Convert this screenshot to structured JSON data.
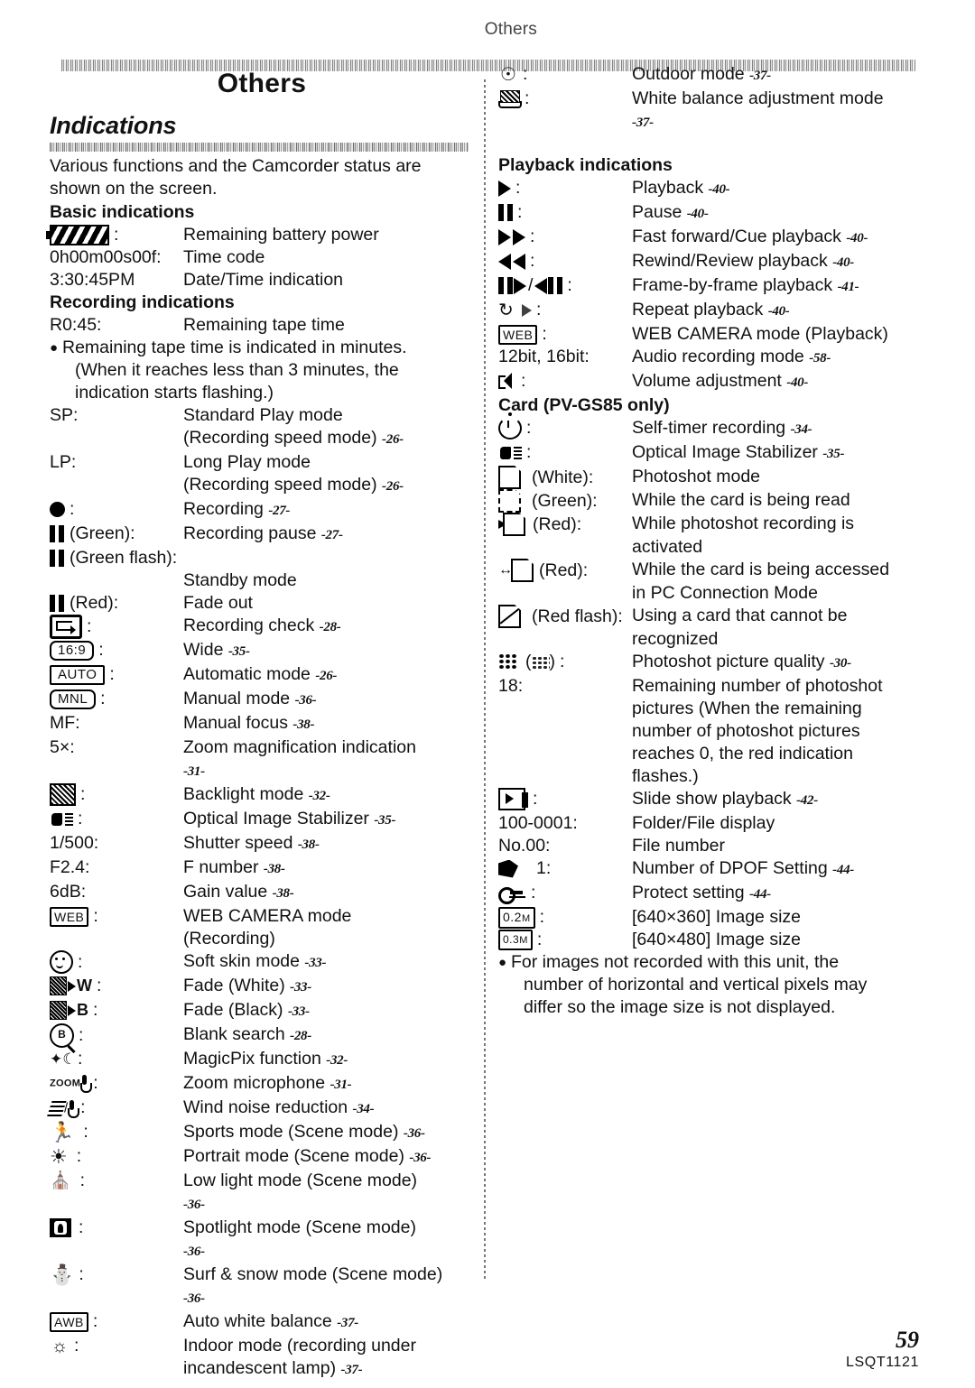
{
  "header": {
    "running_head": "Others"
  },
  "footer": {
    "page_number": "59",
    "doc_code": "LSQT1121"
  },
  "section": {
    "title": "Others",
    "subtitle": "Indications",
    "intro": "Various functions and the Camcorder status are shown on the screen."
  },
  "left_column": {
    "basic_heading": "Basic indications",
    "basic_items": [
      {
        "icon": "battery-icon",
        "term": "",
        "desc": "Remaining battery power",
        "page": ""
      },
      {
        "icon": "",
        "term": "0h00m00s00f:",
        "desc": "Time code",
        "page": ""
      },
      {
        "icon": "",
        "term": "3:30:45PM",
        "desc": "Date/Time indication",
        "page": ""
      }
    ],
    "recording_heading": "Recording indications",
    "recording_items": [
      {
        "icon": "",
        "term": "R0:45:",
        "desc": "Remaining tape time",
        "page": ""
      }
    ],
    "recording_note": "Remaining tape time is indicated in minutes. (When it reaches less than 3 minutes, the indication starts flashing.)",
    "recording_note_lines": [
      "Remaining tape time is indicated in minutes.",
      "(When it reaches less than 3 minutes, the",
      "indication starts flashing.)"
    ],
    "items": [
      {
        "icon": "",
        "term": "SP:",
        "desc": "Standard Play mode",
        "cont": "(Recording speed mode)",
        "page": "-26-"
      },
      {
        "icon": "",
        "term": "LP:",
        "desc": "Long Play mode",
        "cont": "(Recording speed mode)",
        "page": "-26-"
      },
      {
        "icon": "record-dot-icon",
        "term": ":",
        "desc": "Recording",
        "page": "-27-"
      },
      {
        "icon": "pause-bars-icon",
        "term": "(Green):",
        "desc": "Recording pause",
        "page": "-27-"
      },
      {
        "icon": "pause-bars-icon",
        "term": "(Green flash):",
        "desc": "",
        "cont": "Standby mode",
        "page": ""
      },
      {
        "icon": "pause-bars-icon",
        "term": "(Red):",
        "desc": "Fade out",
        "page": ""
      },
      {
        "icon": "recording-check-icon",
        "term": ":",
        "desc": "Recording check",
        "page": "-28-"
      },
      {
        "icon": "wide-16-9-icon",
        "term": ":",
        "desc": "Wide",
        "page": "-35-"
      },
      {
        "icon": "auto-mode-icon",
        "term": ":",
        "desc": "Automatic mode",
        "page": "-26-"
      },
      {
        "icon": "manual-mode-icon",
        "term": ":",
        "desc": "Manual mode",
        "page": "-36-"
      },
      {
        "icon": "",
        "term": "MF:",
        "desc": "Manual focus",
        "page": "-38-"
      },
      {
        "icon": "",
        "term": "5×:",
        "desc": "Zoom magnification indication",
        "cont": "",
        "page": "-31-"
      },
      {
        "icon": "backlight-icon",
        "term": ":",
        "desc": "Backlight mode",
        "page": "-32-"
      },
      {
        "icon": "image-stabilizer-icon",
        "term": ":",
        "desc": "Optical Image Stabilizer",
        "page": "-35-"
      },
      {
        "icon": "",
        "term": "1/500:",
        "desc": "Shutter speed",
        "page": "-38-"
      },
      {
        "icon": "",
        "term": "F2.4:",
        "desc": "F number",
        "page": "-38-"
      },
      {
        "icon": "",
        "term": "6dB:",
        "desc": "Gain value",
        "page": "-38-"
      },
      {
        "icon": "web-camera-icon",
        "term": ":",
        "desc": "WEB CAMERA mode",
        "cont": "(Recording)",
        "page": ""
      },
      {
        "icon": "soft-skin-icon",
        "term": ":",
        "desc": "Soft skin mode",
        "page": "-33-"
      },
      {
        "icon": "fade-white-icon",
        "term": ":",
        "desc": "Fade (White)",
        "page": "-33-"
      },
      {
        "icon": "fade-black-icon",
        "term": ":",
        "desc": "Fade (Black)",
        "page": "-33-"
      },
      {
        "icon": "blank-search-icon",
        "term": ":",
        "desc": "Blank search",
        "page": "-28-"
      },
      {
        "icon": "magicpix-icon",
        "term": ":",
        "desc": "MagicPix function",
        "page": "-32-"
      },
      {
        "icon": "zoom-microphone-icon",
        "term": ":",
        "desc": "Zoom microphone",
        "page": "-31-"
      },
      {
        "icon": "wind-noise-icon",
        "term": ":",
        "desc": "Wind noise reduction",
        "page": "-34-"
      },
      {
        "icon": "sports-mode-icon",
        "term": ":",
        "desc": "Sports mode (Scene mode)",
        "page": "-36-"
      },
      {
        "icon": "portrait-mode-icon",
        "term": ":",
        "desc": "Portrait mode (Scene mode)",
        "page": "-36-"
      },
      {
        "icon": "low-light-mode-icon",
        "term": ":",
        "desc": "Low light mode (Scene mode)",
        "cont": "",
        "page": "-36-"
      },
      {
        "icon": "spotlight-mode-icon",
        "term": ":",
        "desc": "Spotlight mode (Scene mode)",
        "cont": "",
        "page": "-36-"
      },
      {
        "icon": "surf-snow-mode-icon",
        "term": ":",
        "desc": "Surf & snow mode (Scene mode)",
        "cont": "",
        "page": "-36-"
      },
      {
        "icon": "auto-white-balance-icon",
        "term": ":",
        "desc": "Auto white balance",
        "page": "-37-"
      },
      {
        "icon": "indoor-mode-icon",
        "term": ":",
        "desc": "Indoor mode (recording under",
        "cont": "incandescent lamp)",
        "page": "-37-"
      }
    ]
  },
  "right_column": {
    "top_items": [
      {
        "icon": "outdoor-mode-icon",
        "term": ":",
        "desc": "Outdoor mode",
        "page": "-37-"
      },
      {
        "icon": "white-balance-adjust-icon",
        "term": ":",
        "desc": "White balance adjustment mode",
        "cont": "",
        "page": "-37-"
      }
    ],
    "playback_heading": "Playback indications",
    "playback_items": [
      {
        "icon": "play-icon",
        "term": ":",
        "desc": "Playback",
        "page": "-40-"
      },
      {
        "icon": "pause-icon",
        "term": ":",
        "desc": "Pause",
        "page": "-40-"
      },
      {
        "icon": "fast-forward-icon",
        "term": ":",
        "desc": "Fast forward/Cue playback",
        "page": "-40-"
      },
      {
        "icon": "rewind-icon",
        "term": ":",
        "desc": "Rewind/Review playback",
        "page": "-40-"
      },
      {
        "icon": "frame-by-frame-icon",
        "term": ":",
        "desc": "Frame-by-frame playback",
        "page": "-41-"
      },
      {
        "icon": "repeat-playback-icon",
        "term": ":",
        "desc": "Repeat playback",
        "page": "-40-"
      },
      {
        "icon": "web-camera-icon",
        "term": ":",
        "desc": "WEB CAMERA mode (Playback)",
        "page": ""
      },
      {
        "icon": "",
        "term": "12bit, 16bit:",
        "desc": "Audio recording mode",
        "page": "-58-"
      },
      {
        "icon": "volume-icon",
        "term": ":",
        "desc": "Volume adjustment",
        "page": "-40-"
      }
    ],
    "card_heading": "Card (PV-GS85 only)",
    "card_items": [
      {
        "icon": "self-timer-icon",
        "term": ":",
        "desc": "Self-timer recording",
        "page": "-34-"
      },
      {
        "icon": "image-stabilizer-icon",
        "term": ":",
        "desc": "Optical Image Stabilizer",
        "page": "-35-"
      },
      {
        "icon": "card-white-icon",
        "term": "(White):",
        "desc": "Photoshot mode",
        "page": ""
      },
      {
        "icon": "card-green-icon",
        "term": "(Green):",
        "desc": "While the card is being read",
        "page": ""
      },
      {
        "icon": "card-write-icon",
        "term": "(Red):",
        "desc": "While photoshot recording is",
        "cont": "activated",
        "page": ""
      },
      {
        "icon": "card-access-icon",
        "term": "(Red):",
        "desc": "While the card is being accessed",
        "cont": "in PC Connection Mode",
        "page": ""
      },
      {
        "icon": "card-error-icon",
        "term": "(Red flash):",
        "desc": "Using a card that cannot be",
        "cont": "recognized",
        "page": ""
      },
      {
        "icon": "photo-quality-icon",
        "term": "(  ):",
        "desc": "Photoshot picture quality",
        "page": "-30-"
      },
      {
        "icon": "",
        "term": "18:",
        "desc": "Remaining number of photoshot",
        "cont": "pictures (When the remaining number of photoshot pictures reaches 0, the red indication flashes.)",
        "page": ""
      },
      {
        "icon": "slide-show-icon",
        "term": ":",
        "desc": "Slide show playback",
        "page": "-42-"
      },
      {
        "icon": "",
        "term": "100-0001:",
        "desc": "Folder/File display",
        "page": ""
      },
      {
        "icon": "",
        "term": "No.00:",
        "desc": "File number",
        "page": ""
      },
      {
        "icon": "dpof-icon",
        "term": "1:",
        "desc": "Number of DPOF Setting",
        "page": "-44-"
      },
      {
        "icon": "protect-key-icon",
        "term": ":",
        "desc": "Protect setting",
        "page": "-44-"
      },
      {
        "icon": "size-02m-icon",
        "term": ":",
        "desc": "[640×360] Image size",
        "page": ""
      },
      {
        "icon": "size-03m-icon",
        "term": ":",
        "desc": "[640×480] Image size",
        "page": ""
      }
    ],
    "remaining_lines": [
      "Remaining number of photoshot",
      "pictures (When the remaining",
      "number of photoshot pictures",
      "reaches 0, the red indication",
      "flashes.)"
    ],
    "card_note_lines": [
      "For images not recorded with this unit, the",
      "number of horizontal and vertical pixels may",
      "differ so the image size is not displayed."
    ]
  },
  "icon_labels": {
    "wide": "16:9",
    "auto": "AUTO",
    "manual": "MNL",
    "web": "WEB",
    "awb": "AWB",
    "size_02m": "0.2",
    "size_02m_unit": "M",
    "size_03m": "0.3",
    "size_03m_unit": "M",
    "zoom_mic": "ZOOM",
    "blank_b": "B"
  }
}
